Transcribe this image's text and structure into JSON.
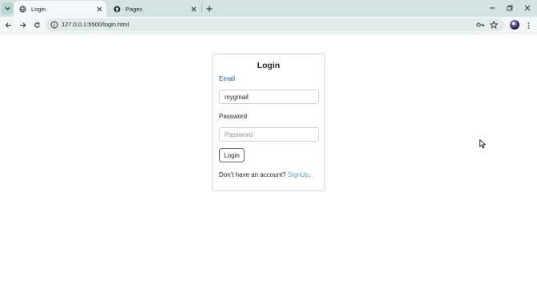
{
  "browser": {
    "tabs": [
      {
        "title": "Login",
        "active": true,
        "icon": "globe-icon"
      },
      {
        "title": "Pages",
        "active": false,
        "icon": "github-icon"
      }
    ],
    "address": "127.0.0.1:5500/login.html"
  },
  "login_form": {
    "title": "Login",
    "email_label": "Email",
    "email_value": "mygmail",
    "password_label": "Password",
    "password_placeholder": "Password",
    "submit_label": "Login",
    "signup_prompt": "Don't have an account?",
    "signup_link": "SignUp",
    "signup_suffix": "."
  },
  "colors": {
    "tabstrip": "#d3e3e3",
    "toolbar": "#f2f7f7",
    "email_label": "#0d5b9f",
    "link": "#5aa0d6"
  }
}
